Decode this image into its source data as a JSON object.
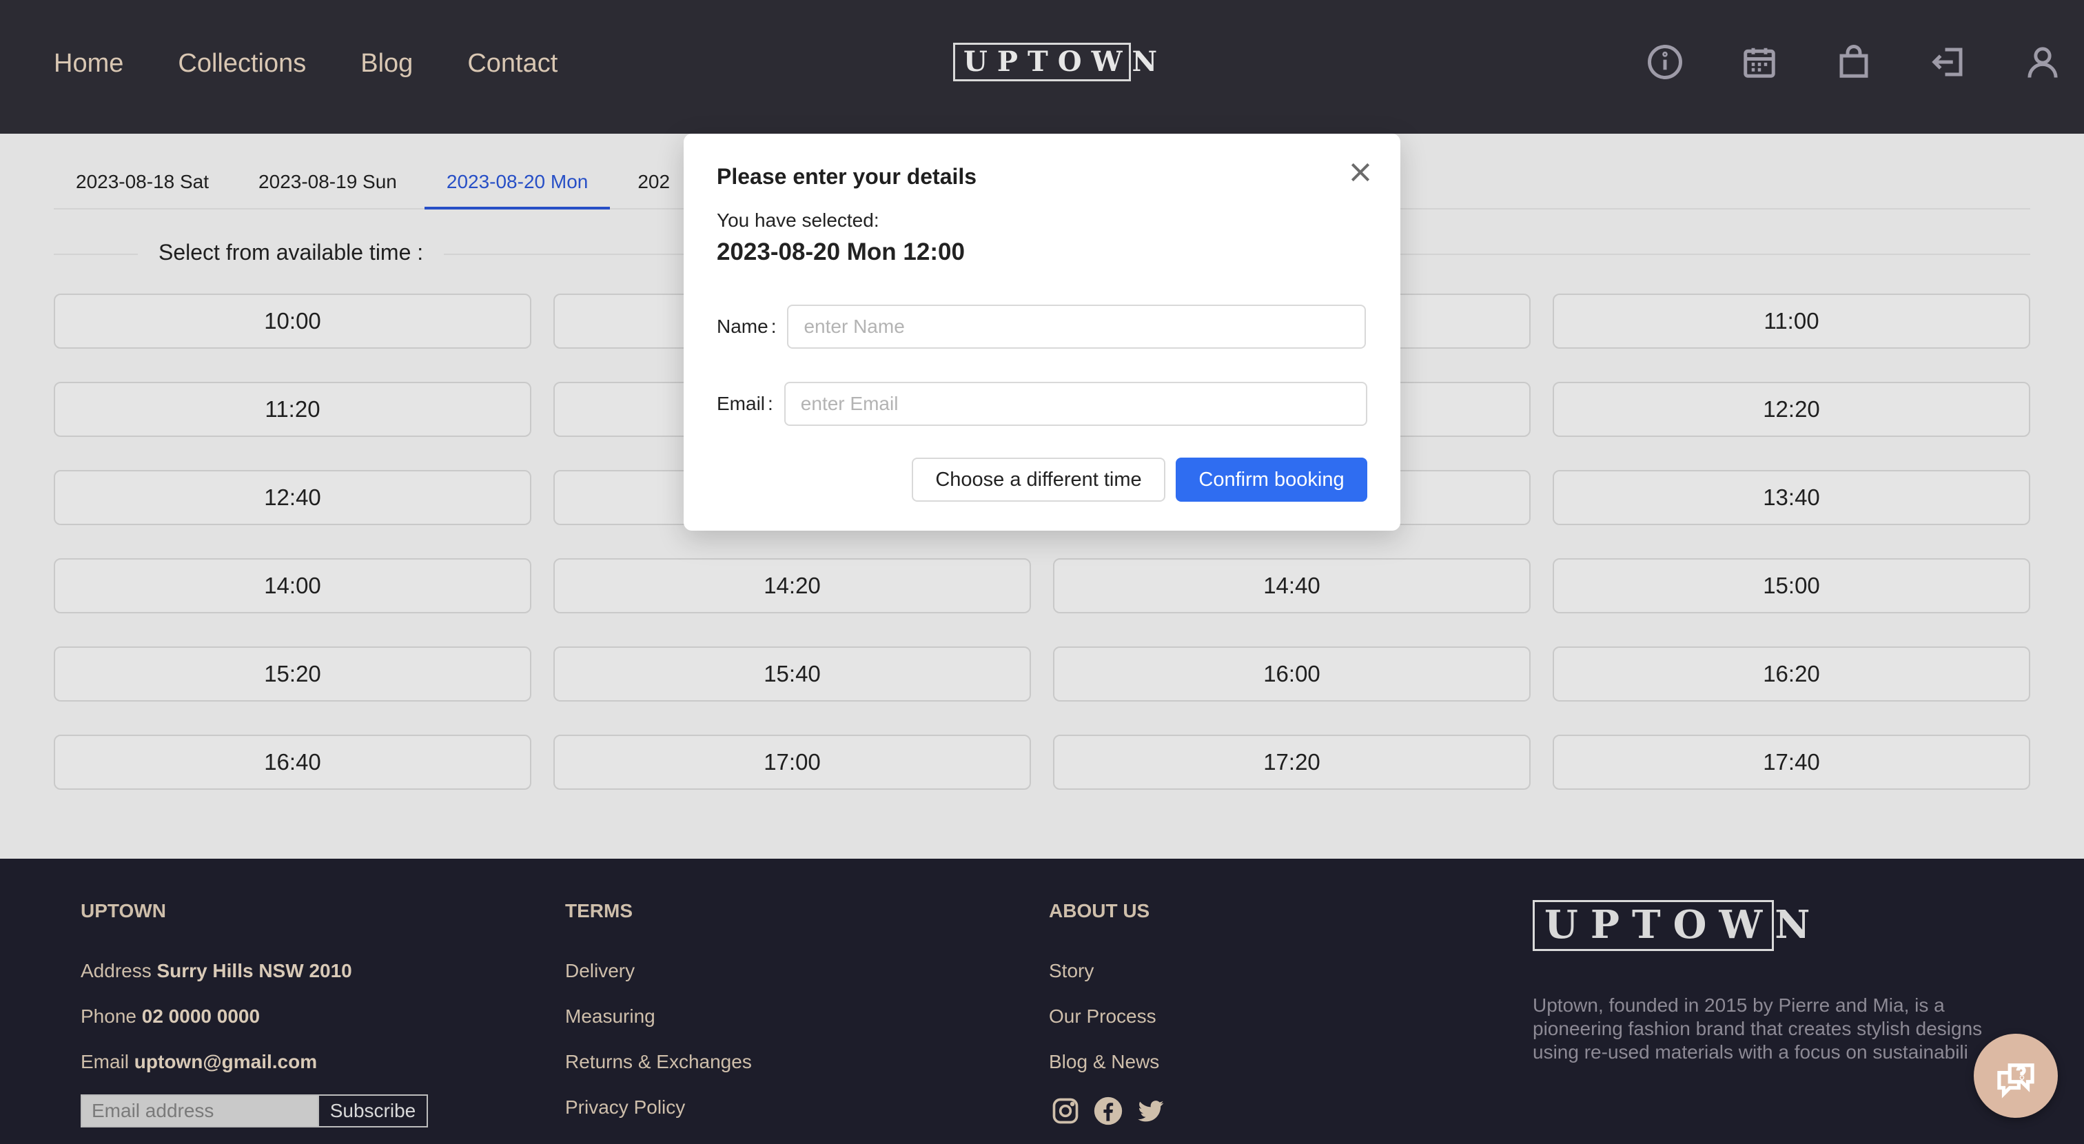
{
  "header": {
    "nav": [
      {
        "label": "Home"
      },
      {
        "label": "Collections"
      },
      {
        "label": "Blog"
      },
      {
        "label": "Contact"
      }
    ],
    "logo": "UPTOWN",
    "icons": [
      "info-icon",
      "calendar-icon",
      "shopping-bag-icon",
      "login-icon",
      "user-icon"
    ]
  },
  "booking": {
    "tabs": [
      {
        "label": "2023-08-18 Sat"
      },
      {
        "label": "2023-08-19 Sun"
      },
      {
        "label": "2023-08-20 Mon"
      },
      {
        "label": "202"
      }
    ],
    "active_tab": "2023-08-20 Mon",
    "select_label": "Select from available time :",
    "slots": [
      "10:00",
      "",
      "",
      "11:00",
      "11:20",
      "",
      "",
      "12:20",
      "12:40",
      "",
      "",
      "13:40",
      "14:00",
      "14:20",
      "14:40",
      "15:00",
      "15:20",
      "15:40",
      "16:00",
      "16:20",
      "16:40",
      "17:00",
      "17:20",
      "17:40"
    ]
  },
  "modal": {
    "title": "Please enter your details",
    "selected_label": "You have selected:",
    "selected_value": "2023-08-20 Mon 12:00",
    "name_label": "Name",
    "name_placeholder": "enter Name",
    "email_label": "Email",
    "email_placeholder": "enter Email",
    "colon": ":",
    "secondary_button": "Choose a different time",
    "primary_button": "Confirm booking"
  },
  "footer": {
    "col1": {
      "heading": "UPTOWN",
      "address_label": "Address",
      "address_value": "Surry Hills NSW 2010",
      "phone_label": "Phone",
      "phone_value": "02 0000 0000",
      "email_label": "Email",
      "email_value": "uptown@gmail.com",
      "subscribe_placeholder": "Email address",
      "subscribe_button": "Subscribe"
    },
    "col2": {
      "heading": "TERMS",
      "items": [
        "Delivery",
        "Measuring",
        "Returns & Exchanges",
        "Privacy Policy"
      ]
    },
    "col3": {
      "heading": "ABOUT US",
      "items": [
        "Story",
        "Our Process",
        "Blog & News"
      ],
      "social": [
        "instagram-icon",
        "facebook-icon",
        "twitter-icon"
      ]
    },
    "logo": "UPTOWN",
    "description": "Uptown, founded in 2015 by Pierre and Mia, is a pioneering fashion brand that creates stylish designs using re-used materials with a focus on sustainabili"
  },
  "chat_icon": "chat-help-icon"
}
